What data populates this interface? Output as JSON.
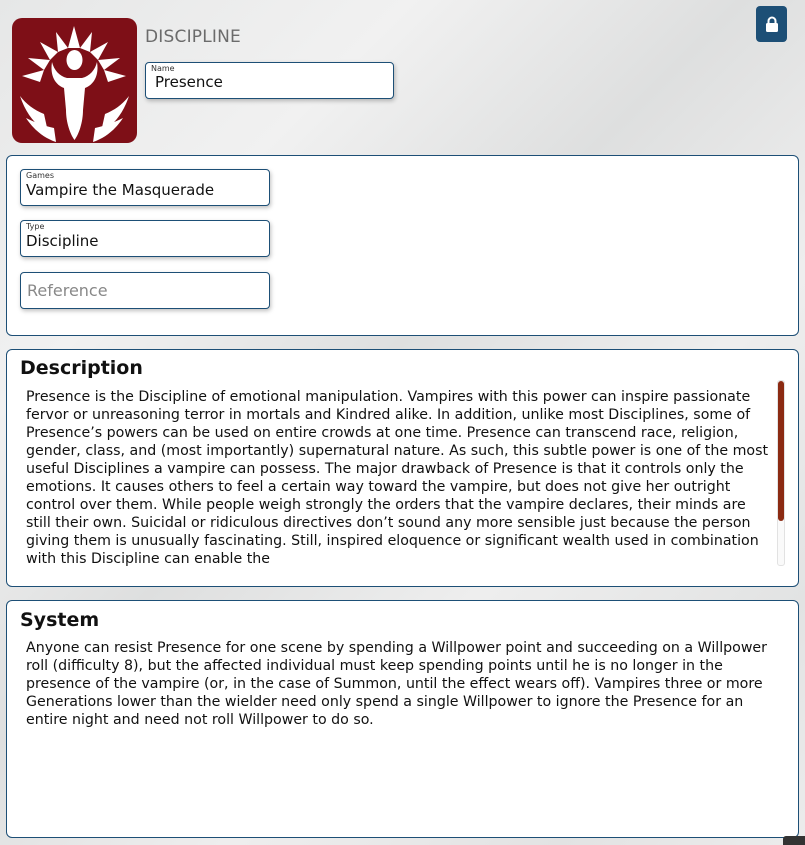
{
  "header": {
    "kind_label": "DISCIPLINE",
    "emblem_icon": "presence-figure-icon",
    "lock_icon": "lock-icon",
    "name_field": {
      "label": "Name",
      "value": "Presence"
    }
  },
  "details": {
    "games_field": {
      "label": "Games",
      "value": "Vampire the Masquerade"
    },
    "type_field": {
      "label": "Type",
      "value": "Discipline"
    },
    "reference_field": {
      "placeholder": "Reference",
      "value": ""
    }
  },
  "description": {
    "heading": "Description",
    "text": "Presence is the Discipline of emotional manipulation. Vampires with this power can inspire passionate fervor or unreasoning terror in mortals and Kindred alike. In addition, unlike most Disciplines, some of Presence’s powers can be used on entire crowds at one time. Presence can transcend race, religion, gender, class, and (most importantly) supernatural nature. As such, this subtle power is one of the most useful Disciplines a vampire can possess. The major drawback of Presence is that it controls only the emotions. It causes others to feel a certain way toward the vampire, but does not give her outright control over them. While people weigh strongly the orders that the vampire declares, their minds are still their own. Suicidal or ridiculous directives don’t sound any more sensible just because the person giving them is unusually fascinating. Still, inspired eloquence or significant wealth used in combination with this Discipline can enable the"
  },
  "system": {
    "heading": "System",
    "text": "Anyone can resist Presence for one scene by spending a Willpower point and succeeding on a Willpower roll (difficulty 8), but the affected individual must keep spending points until he is no longer in the presence of the vampire (or, in the case of Summon, until the effect wears off). Vampires three or more Generations lower than the wielder need only spend a single Willpower to ignore the Presence for an entire night and need not roll Willpower to do so."
  },
  "colors": {
    "emblem_bg": "#7e0f17",
    "accent_blue": "#1d4f76",
    "scroll_thumb": "#8b2a12"
  }
}
